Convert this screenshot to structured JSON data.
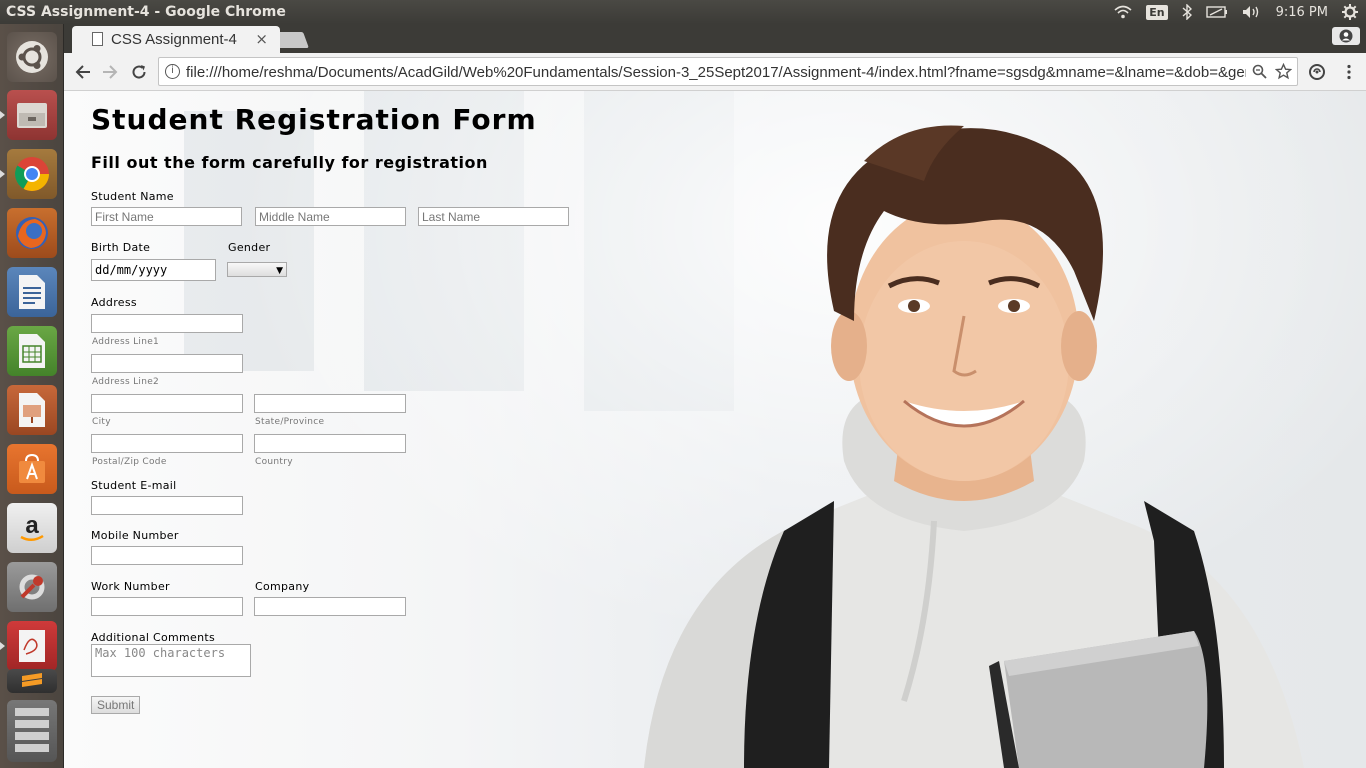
{
  "window": {
    "title": "CSS Assignment-4 - Google Chrome"
  },
  "tray": {
    "keyboard": "En",
    "time": "9:16 PM"
  },
  "tab": {
    "title": "CSS Assignment-4",
    "close": "×"
  },
  "omnibox": {
    "url": "file:///home/reshma/Documents/AcadGild/Web%20Fundamentals/Session-3_25Sept2017/Assignment-4/index.html?fname=sgsdg&mname=&lname=&dob=&gender=..."
  },
  "launcher": {
    "apps": [
      "ubuntu-dash",
      "files",
      "chrome",
      "firefox",
      "writer",
      "calc",
      "impress",
      "software-center",
      "amazon",
      "system-settings",
      "document-viewer",
      "sublime",
      "workspace-switcher"
    ]
  },
  "form": {
    "title": "Student Registration Form",
    "subtitle": "Fill out the form carefully for registration",
    "student_name_label": "Student Name",
    "first_name_placeholder": "First Name",
    "middle_name_placeholder": "Middle Name",
    "last_name_placeholder": "Last Name",
    "birth_date_label": "Birth Date",
    "birth_date_value": "dd/mm/yyyy",
    "gender_label": "Gender",
    "address_label": "Address",
    "address_line1": "Address Line1",
    "address_line2": "Address Line2",
    "city": "City",
    "state": "State/Province",
    "postal": "Postal/Zip Code",
    "country": "Country",
    "email_label": "Student E-mail",
    "mobile_label": "Mobile Number",
    "work_label": "Work Number",
    "company_label": "Company",
    "comments_label": "Additional Comments",
    "comments_placeholder": "Max 100 characters",
    "submit": "Submit"
  }
}
